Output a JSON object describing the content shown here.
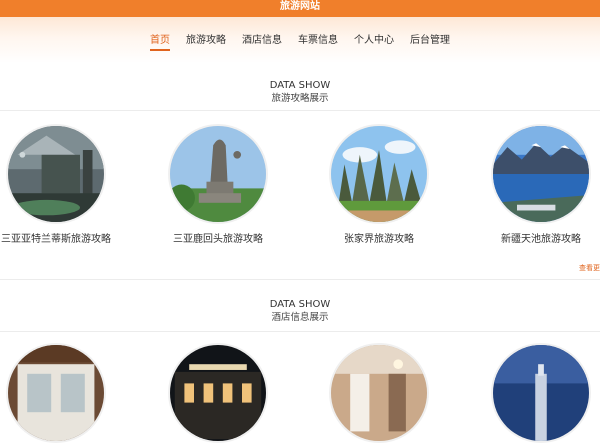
{
  "header": {
    "site_title": "旅游网站"
  },
  "nav": {
    "items": [
      {
        "label": "首页",
        "active": true
      },
      {
        "label": "旅游攻略"
      },
      {
        "label": "酒店信息"
      },
      {
        "label": "车票信息"
      },
      {
        "label": "个人中心"
      },
      {
        "label": "后台管理"
      }
    ]
  },
  "travel_section": {
    "title_en": "DATA SHOW",
    "title_zh": "旅游攻略展示",
    "items": [
      {
        "caption": "三亚亚特兰蒂斯旅游攻略"
      },
      {
        "caption": "三亚鹿回头旅游攻略"
      },
      {
        "caption": "张家界旅游攻略"
      },
      {
        "caption": "新疆天池旅游攻略"
      }
    ],
    "more_label": "查看更"
  },
  "hotel_section": {
    "title_en": "DATA SHOW",
    "title_zh": "酒店信息展示"
  },
  "colors": {
    "accent": "#f07f2b",
    "active_nav": "#e0641e"
  }
}
